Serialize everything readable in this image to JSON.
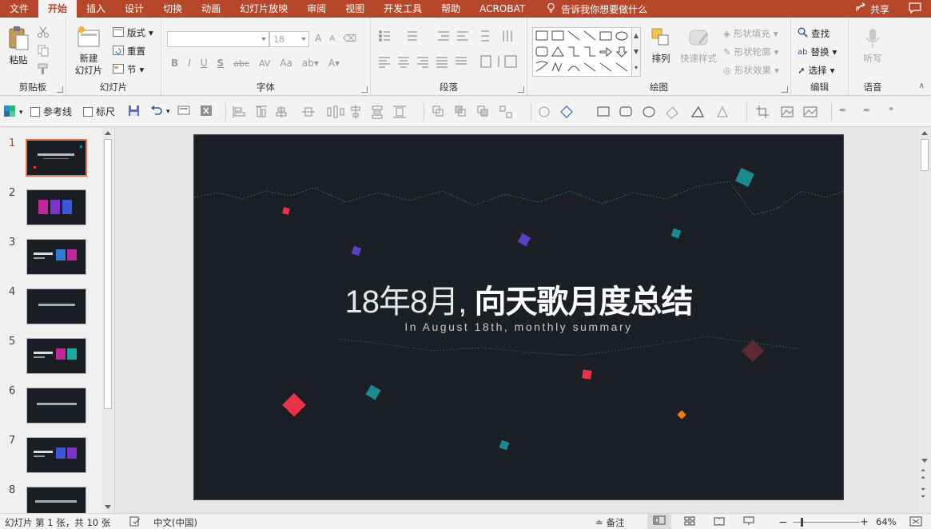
{
  "menu": {
    "tabs": [
      "文件",
      "开始",
      "插入",
      "设计",
      "切换",
      "动画",
      "幻灯片放映",
      "审阅",
      "视图",
      "开发工具",
      "帮助",
      "ACROBAT"
    ],
    "active_tab": "开始",
    "tell_me": "告诉我你想要做什么",
    "share": "共享"
  },
  "ribbon": {
    "clipboard": {
      "label": "剪贴板",
      "paste": "粘贴"
    },
    "slides": {
      "label": "幻灯片",
      "new_slide_l1": "新建",
      "new_slide_l2": "幻灯片",
      "layout": "版式",
      "reset": "重置",
      "section": "节"
    },
    "font": {
      "label": "字体",
      "font_name": "",
      "font_size": "18",
      "bold": "B",
      "italic": "I",
      "underline": "U",
      "shadow": "S",
      "strike": "abc",
      "spacing": "AV",
      "case": "Aa",
      "grow": "A",
      "shrink": "A"
    },
    "paragraph": {
      "label": "段落"
    },
    "drawing": {
      "label": "绘图",
      "arrange": "排列",
      "quick_styles": "快速样式",
      "shape_fill": "形状填充",
      "shape_outline": "形状轮廓",
      "shape_effects": "形状效果"
    },
    "editing": {
      "label": "编辑",
      "find": "查找",
      "replace": "替换",
      "select": "选择"
    },
    "voice": {
      "label": "语音",
      "dictate": "听写"
    }
  },
  "qat": {
    "guides": "参考线",
    "ruler": "标尺"
  },
  "thumbnails": {
    "numbers": [
      "1",
      "2",
      "3",
      "4",
      "5",
      "6",
      "7",
      "8"
    ],
    "active_index": 0
  },
  "slide": {
    "title_light": "18年8月, ",
    "title_bold": "向天歌月度总结",
    "subtitle": "In August 18th, monthly summary"
  },
  "status": {
    "slide_info": "幻灯片 第 1 张，共 10 张",
    "language": "中文(中国)",
    "notes": "备注",
    "zoom": "64%"
  },
  "colors": {
    "accent": "#b7472a",
    "slide_bg": "#1b1e25",
    "teal": "#1a8a8f",
    "red": "#e83245",
    "purple": "#5a3fc0",
    "orange": "#f07a12",
    "maroon": "#5a2a30"
  }
}
